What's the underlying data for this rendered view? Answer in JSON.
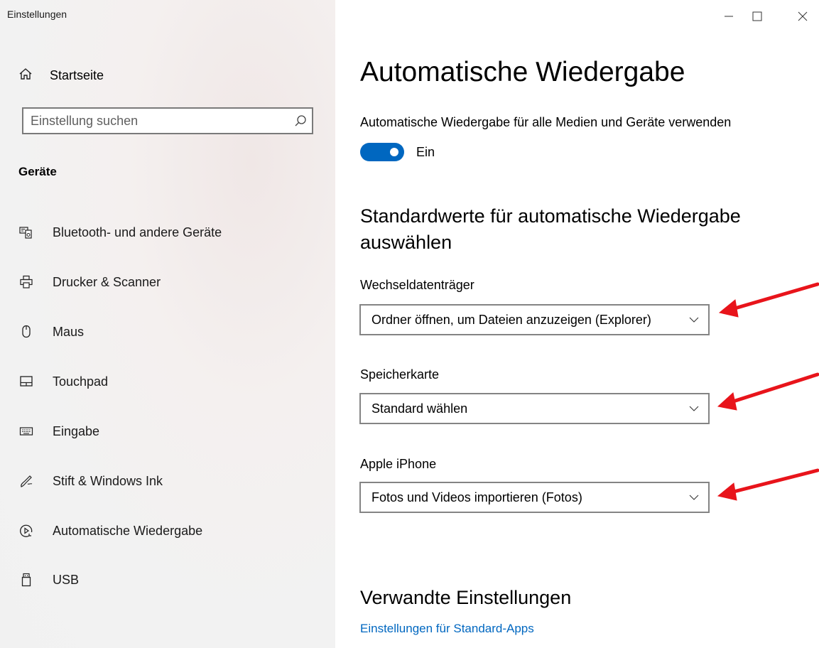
{
  "window": {
    "title": "Einstellungen",
    "controls": [
      "minimize",
      "maximize",
      "close"
    ]
  },
  "sidebar": {
    "home_label": "Startseite",
    "search": {
      "placeholder": "Einstellung suchen",
      "value": ""
    },
    "section_title": "Geräte",
    "items": [
      {
        "label": "Bluetooth- und andere Geräte",
        "icon": "bluetooth-devices-icon"
      },
      {
        "label": "Drucker & Scanner",
        "icon": "printer-icon"
      },
      {
        "label": "Maus",
        "icon": "mouse-icon"
      },
      {
        "label": "Touchpad",
        "icon": "touchpad-icon"
      },
      {
        "label": "Eingabe",
        "icon": "keyboard-icon"
      },
      {
        "label": "Stift & Windows Ink",
        "icon": "pen-icon"
      },
      {
        "label": "Automatische Wiedergabe",
        "icon": "autoplay-icon",
        "selected": true
      },
      {
        "label": "USB",
        "icon": "usb-icon"
      }
    ]
  },
  "main": {
    "title": "Automatische Wiedergabe",
    "toggle": {
      "caption": "Automatische Wiedergabe für alle Medien und Geräte verwenden",
      "state_label": "Ein",
      "on": true
    },
    "defaults_heading_line1": "Standardwerte für automatische Wiedergabe",
    "defaults_heading_line2": "auswählen",
    "fields": [
      {
        "label": "Wechseldatenträger",
        "value": "Ordner öffnen, um Dateien anzuzeigen (Explorer)"
      },
      {
        "label": "Speicherkarte",
        "value": "Standard wählen"
      },
      {
        "label": "Apple iPhone",
        "value": "Fotos und Videos importieren (Fotos)"
      }
    ],
    "related": {
      "title": "Verwandte Einstellungen",
      "link": "Einstellungen für Standard-Apps"
    }
  },
  "colors": {
    "accent": "#0067c0",
    "annotation_arrow": "#e8141b",
    "link": "#0067c0"
  }
}
